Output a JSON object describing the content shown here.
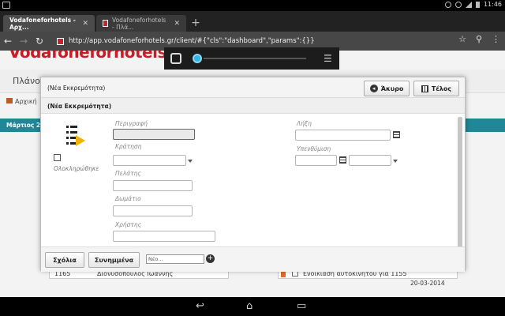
{
  "status": {
    "time": "11:46"
  },
  "tabs": [
    {
      "title": "Vodafoneforhotels - Αρχ...",
      "active": true
    },
    {
      "title": "Vodafoneforhotels - Πλά...",
      "active": false
    }
  ],
  "address": {
    "url": "http://app.vodafoneforhotels.gr/client/#{\"cls\":\"dashboard\",\"params\":{}}"
  },
  "site": {
    "logo": "Vodafoneforhotels",
    "nav_text": "Πλάνο",
    "breadcrumb": "Αρχική",
    "teal_label": "Μάρτιος 2",
    "row_left": {
      "id": "1165",
      "name": "Διονυσόπουλος Ιωάννης"
    },
    "row_right": {
      "text": "Ενοικίαση αυτοκινήτου για 1155",
      "date": "20-03-2014"
    }
  },
  "modal": {
    "title": "(Νέα Εκκρεμότητα)",
    "subtitle": "(Νέα Εκκρεμότητα)",
    "cancel_label": "Άκυρο",
    "end_label": "Τέλος",
    "completed_label": "Ολοκληρώθηκε",
    "fields": {
      "description": "Περιγραφή",
      "booking": "Κράτηση",
      "customer": "Πελάτης",
      "room": "Δωμάτιο",
      "user": "Χρήστης",
      "expiry": "Λήξη",
      "reminder": "Υπενθύμιση"
    },
    "footer": {
      "comments_label": "Σχόλια",
      "attachments_label": "Συνημμένα",
      "new_placeholder": "Νέο..."
    }
  },
  "colors": {
    "brand_red": "#c81d25",
    "teal": "#1f8797",
    "media_accent": "#33b5e5"
  }
}
